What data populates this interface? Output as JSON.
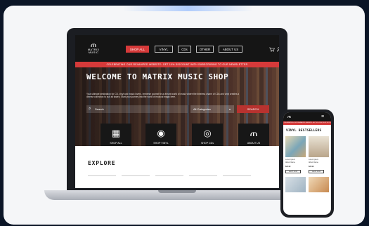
{
  "brand": {
    "glyph": "ጠ",
    "wordmark": "MATRIX MUSIC",
    "accent": "#d63a3a"
  },
  "nav": {
    "items": [
      {
        "label": "SHOP ALL",
        "active": true
      },
      {
        "label": "VINYL"
      },
      {
        "label": "CDs"
      },
      {
        "label": "OTHER"
      },
      {
        "label": "ABOUT US"
      }
    ],
    "cart_icon": "cart-icon",
    "account_icon": "user-icon"
  },
  "promo": {
    "text": "CELEBRATING OUR REVAMPED WEBSITE: GET 10% DISCOUNT WITH SUBSCRIBING TO OUR NEWSLETTER"
  },
  "hero": {
    "title": "WELCOME TO MATRIX MUSIC SHOP",
    "subtitle": "Your ultimate destination for CD, vinyl and music lovers. Immerse yourself in a vibrant world of music where the timeless charm of CDs and vinyl creates a diverse collection to suit all tastes. Start your journey into the world of musical magic here.",
    "search_placeholder": "Search",
    "category": "All Categories",
    "search_button": "SEARCH"
  },
  "tiles": [
    {
      "label": "SHOP ALL",
      "icon": "vinyl-records-icon",
      "glyph": "▦"
    },
    {
      "label": "SHOP VINYL",
      "icon": "turntable-icon",
      "glyph": "◉"
    },
    {
      "label": "SHOP CDs",
      "icon": "cd-player-icon",
      "glyph": "◎"
    },
    {
      "label": "ABOUT US",
      "icon": "matrix-logo-icon",
      "glyph": "ጠ"
    }
  ],
  "explore": {
    "title": "EXPLORE"
  },
  "phone": {
    "logo": "ጠ",
    "promo": "CELEBRATING OUR REVAMPED WEBSITE: GET 10% DISCOUNT WITH SUBSCRIBING TO OUR NEWSLETTER",
    "title": "VINYL BESTSELLERS",
    "products": [
      {
        "artist": "Lorem Ipsum",
        "album": "Album Name",
        "price": "$24.99",
        "button": "SHOP NOW"
      },
      {
        "artist": "Lorem Ipsum",
        "album": "Album Name",
        "price": "$22.99",
        "button": "SHOP NOW"
      }
    ]
  }
}
